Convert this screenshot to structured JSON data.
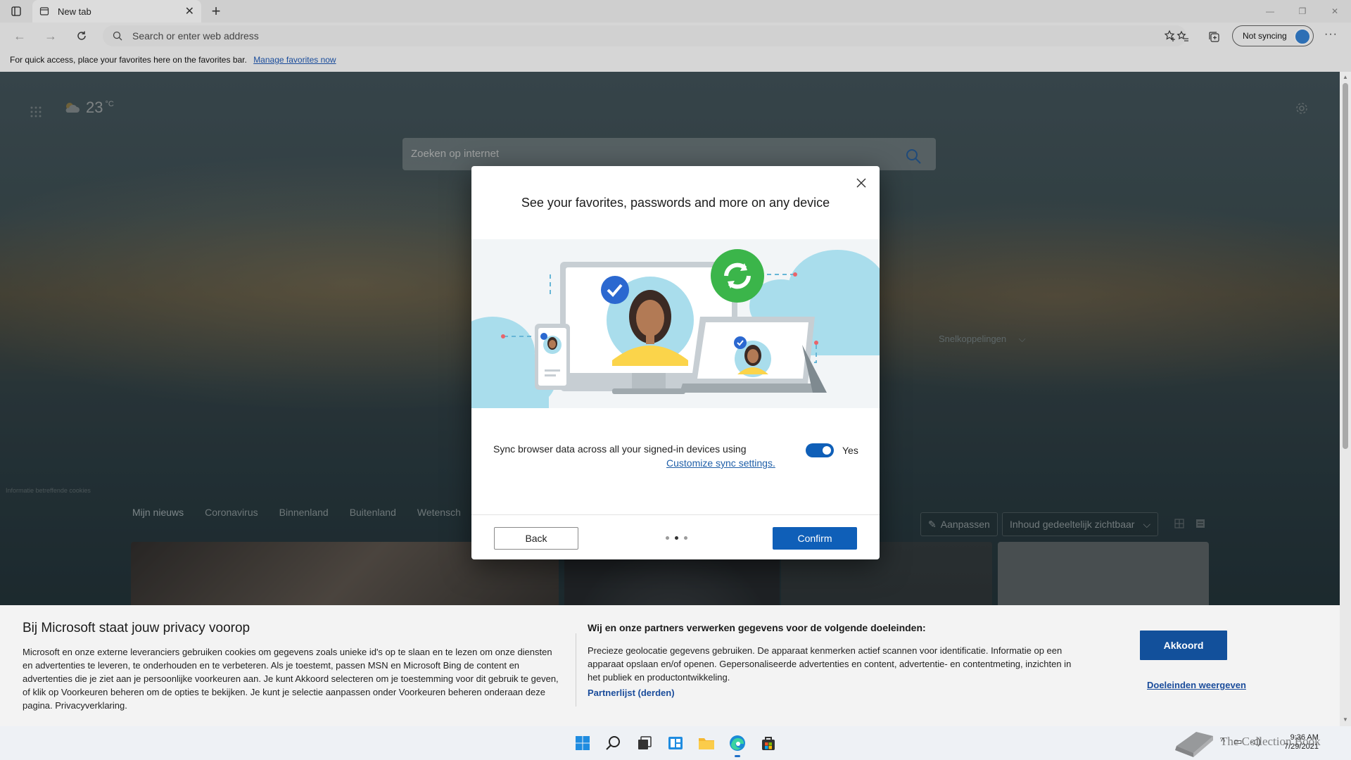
{
  "browser": {
    "tab_title": "New tab",
    "address_placeholder": "Search or enter web address",
    "sync_label": "Not syncing",
    "favbar_text": "For quick access, place your favorites here on the favorites bar.",
    "favbar_link": "Manage favorites now"
  },
  "newtab": {
    "temperature": "23",
    "temp_unit": "°C",
    "search_placeholder": "Zoeken op internet",
    "quick_links": "Snelkoppelingen",
    "cookie_info": "Informatie betreffende cookies",
    "feed_tabs": [
      "Mijn nieuws",
      "Coronavirus",
      "Binnenland",
      "Buitenland",
      "Wetensch"
    ],
    "customize_label": "Aanpassen",
    "content_visibility": "Inhoud gedeeltelijk zichtbaar"
  },
  "modal": {
    "title": "See your favorites, passwords and more on any device",
    "sync_text": "Sync browser data across all your signed-in devices using",
    "sync_link": "Customize sync settings.",
    "toggle_label": "Yes",
    "toggle_on": true,
    "back_label": "Back",
    "confirm_label": "Confirm",
    "steps_total": 3,
    "current_step": 2
  },
  "privacy": {
    "title": "Bij Microsoft staat jouw privacy voorop",
    "body": "Microsoft en onze externe leveranciers gebruiken cookies om gegevens zoals unieke id's op te slaan en te lezen om onze diensten en advertenties te leveren, te onderhouden en te verbeteren. Als je toestemt, passen MSN en Microsoft Bing de content en advertenties die je ziet aan je persoonlijke voorkeuren aan. Je kunt Akkoord selecteren om je toestemming voor dit gebruik te geven, of klik op Voorkeuren beheren om de opties te bekijken. Je kunt je selectie aanpassen onder Voorkeuren beheren onderaan deze pagina. Privacyverklaring.",
    "right_title": "Wij en onze partners verwerken gegevens voor de volgende doeleinden:",
    "right_body": "Precieze geolocatie gegevens gebruiken. De apparaat kenmerken actief scannen voor identificatie. Informatie op een apparaat opslaan en/of openen. Gepersonaliseerde advertenties en content, advertentie- en contentmeting, inzichten in het publiek en productontwikkeling.",
    "partners_link": "Partnerlijst (derden)",
    "accept_label": "Akkoord",
    "purposes_link": "Doeleinden weergeven"
  },
  "taskbar": {
    "time": "9:36 AM",
    "date": "7/29/2021",
    "watermark": "The Collection Book"
  },
  "colors": {
    "accent": "#0f5fb8",
    "sync_green": "#3bb54a",
    "privacy_button": "#12509b"
  },
  "icons": [
    "sidebar-icon",
    "tab-page-icon",
    "close-icon",
    "plus-icon",
    "back-arrow-icon",
    "forward-arrow-icon",
    "refresh-icon",
    "search-icon",
    "star-add-icon",
    "favorites-icon",
    "collections-icon",
    "more-icon",
    "apps-grid-icon",
    "weather-cloud-icon",
    "gear-icon",
    "chevron-down-icon",
    "edit-pencil-icon",
    "grid-view-icon",
    "list-view-icon",
    "windows-start-icon",
    "taskbar-search-icon",
    "task-view-icon",
    "widgets-icon",
    "file-explorer-icon",
    "edge-icon",
    "store-icon"
  ]
}
